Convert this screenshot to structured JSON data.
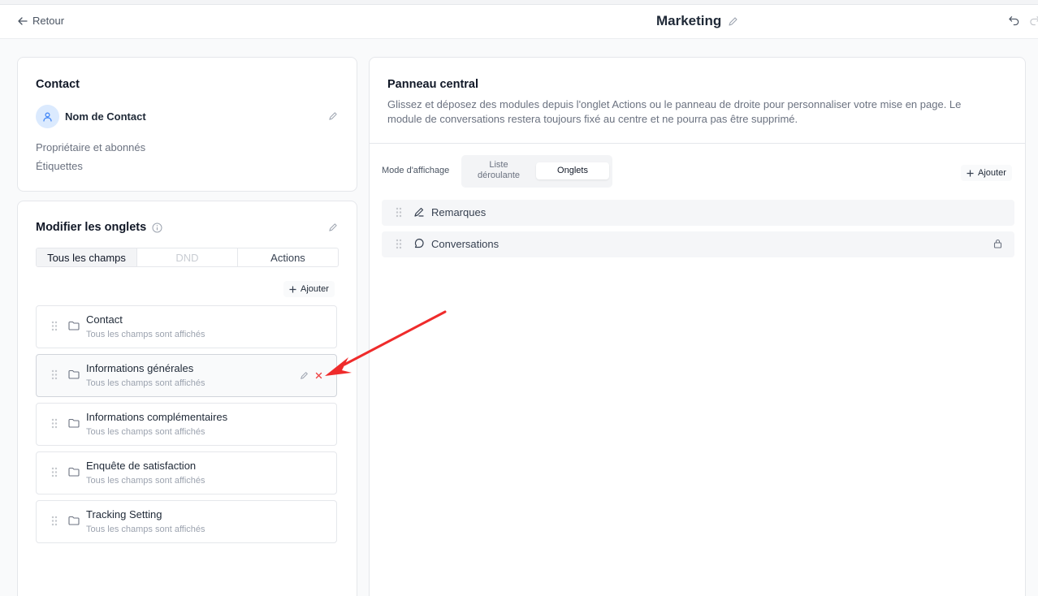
{
  "topbar": {
    "back_label": "Retour",
    "title": "Marketing"
  },
  "contact_card": {
    "title": "Contact",
    "contact_name": "Nom de Contact",
    "links": [
      "Propriétaire et abonnés",
      "Étiquettes"
    ]
  },
  "tabs_card": {
    "title": "Modifier les onglets",
    "segments": [
      "Tous les champs",
      "DND",
      "Actions"
    ],
    "add_label": "Ajouter",
    "fields": [
      {
        "name": "Contact",
        "sub": "Tous les champs sont affichés"
      },
      {
        "name": "Informations générales",
        "sub": "Tous les champs sont affichés"
      },
      {
        "name": "Informations complémentaires",
        "sub": "Tous les champs sont affichés"
      },
      {
        "name": "Enquête de satisfaction",
        "sub": "Tous les champs sont affichés"
      },
      {
        "name": "Tracking Setting",
        "sub": "Tous les champs sont affichés"
      }
    ]
  },
  "central": {
    "title": "Panneau central",
    "description": "Glissez et déposez des modules depuis l'onglet Actions ou le panneau de droite pour personnaliser votre mise en page. Le module de conversations restera toujours fixé au centre et ne pourra pas être supprimé.",
    "mode_label": "Mode d'affichage",
    "mode_options": [
      "Liste déroulante",
      "Onglets"
    ],
    "mode_selected": "Onglets",
    "add_label": "Ajouter",
    "modules": [
      {
        "label": "Remarques",
        "icon": "pencil-icon",
        "locked": false
      },
      {
        "label": "Conversations",
        "icon": "chat-bubble-icon",
        "locked": true
      }
    ]
  },
  "colors": {
    "annotation_arrow": "#ef2b2b",
    "delete_icon": "#ef4444",
    "avatar_bg": "#dbeafe"
  }
}
